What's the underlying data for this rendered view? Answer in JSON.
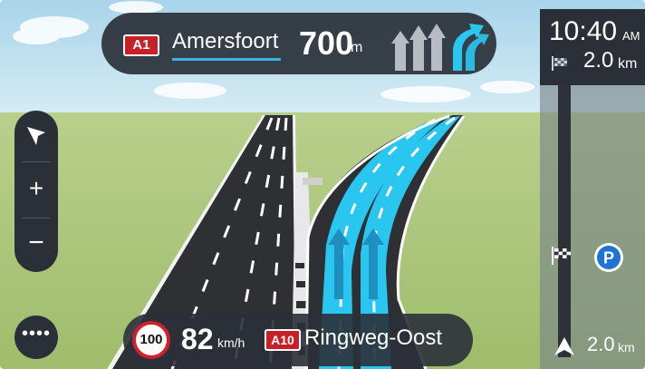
{
  "instruction": {
    "road_number": "A1",
    "street": "Amersfoort",
    "distance": "700",
    "distance_unit": "m",
    "lane_icons": "lane-guidance-arrows-icon"
  },
  "eta": {
    "time": "10:40",
    "ampm": "AM",
    "remaining_distance": "2.0",
    "remaining_unit": "km"
  },
  "route_bar": {
    "next_distance": "2.0",
    "next_unit": "km",
    "poi_label": "P"
  },
  "speed": {
    "limit": "100",
    "current": "82",
    "unit": "km/h"
  },
  "current_street": {
    "road_number": "A10",
    "name": "Ringweg-Oost"
  },
  "controls": {
    "zoom_in": "+",
    "zoom_out": "−",
    "menu": "••••"
  },
  "colors": {
    "panel": "#2b3038",
    "accent_blue": "#3fb0e6",
    "lane_cyan": "#29c6f0",
    "shield_red": "#c62128",
    "grass": "#a8c47a",
    "sky": "#bfe0ee"
  }
}
